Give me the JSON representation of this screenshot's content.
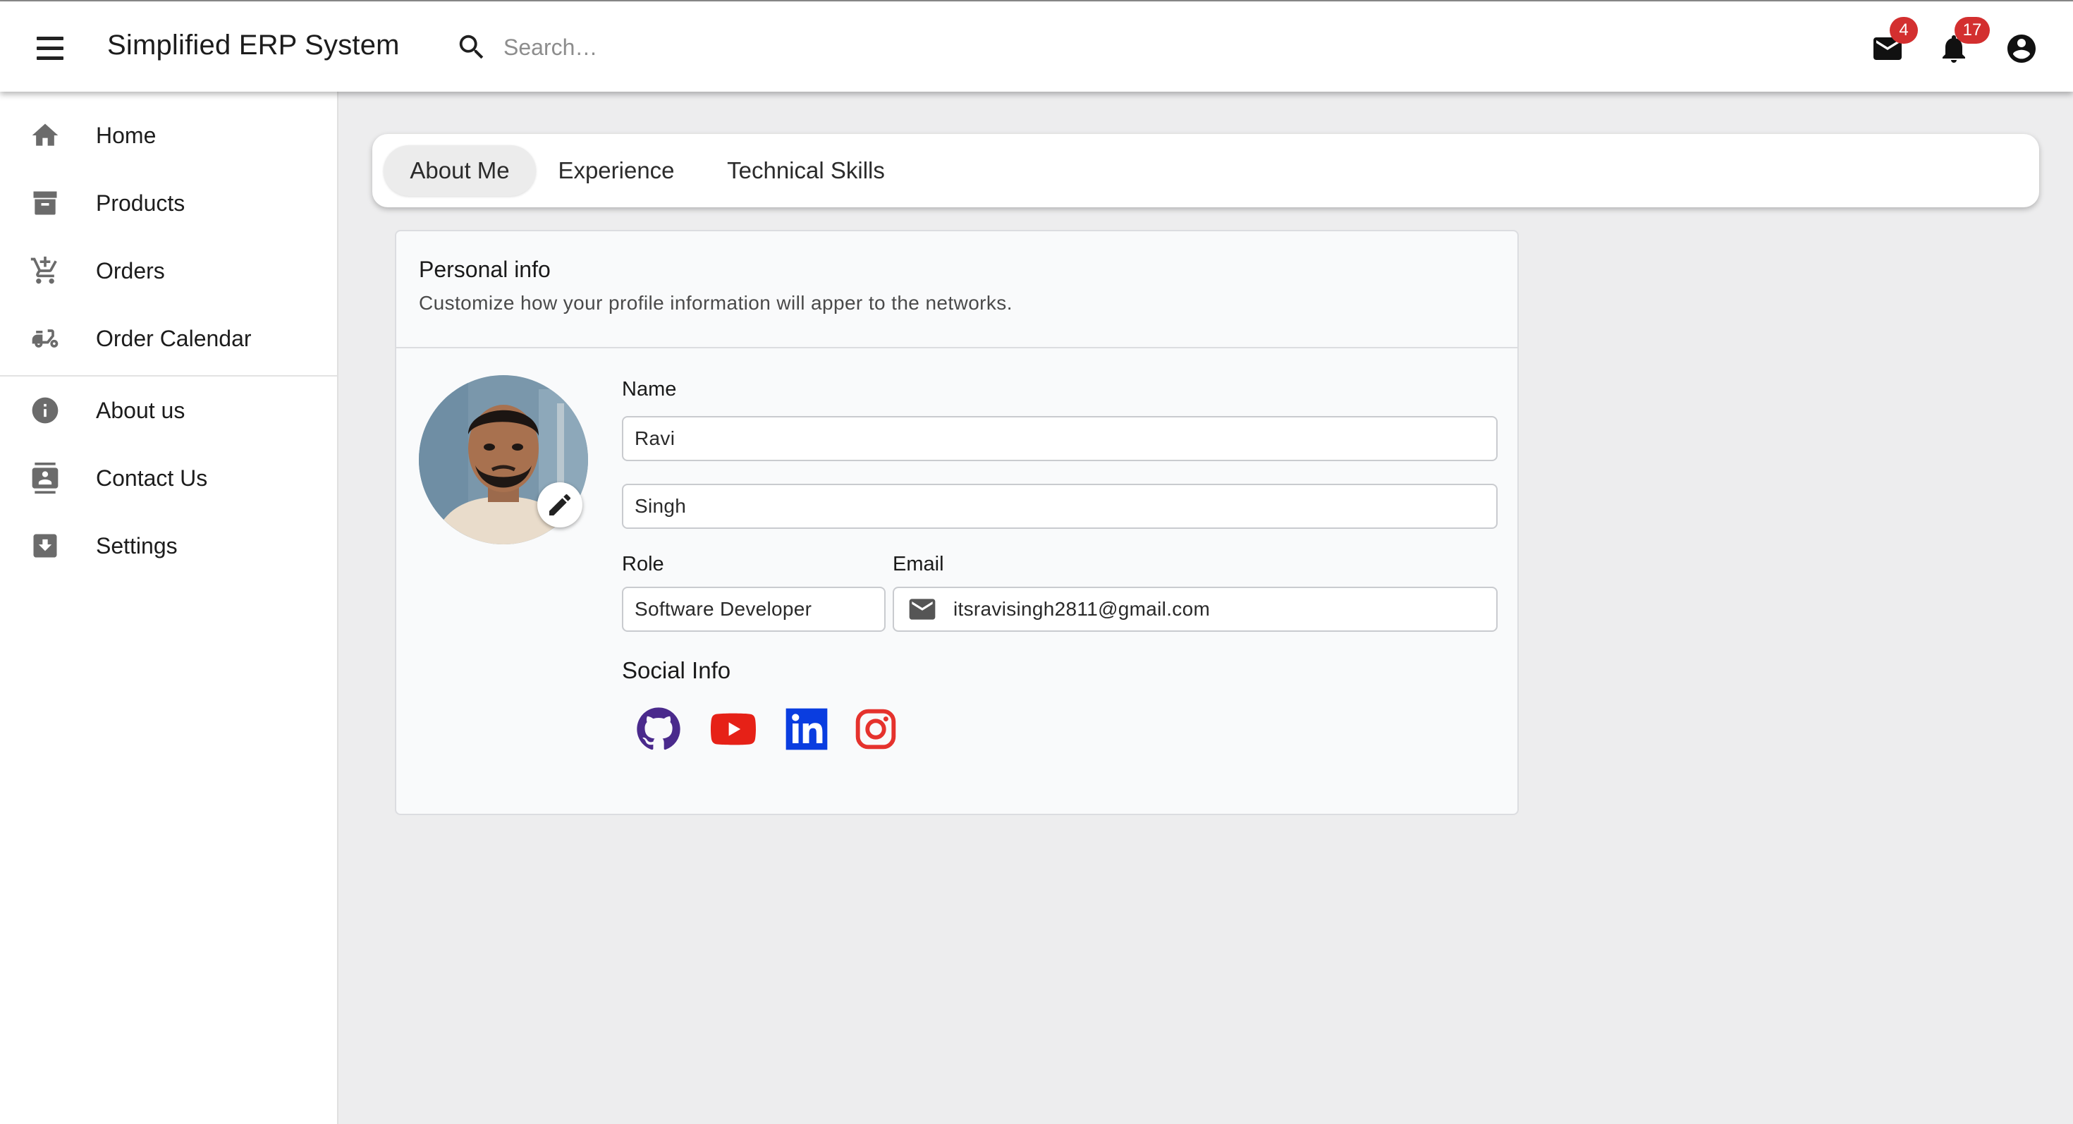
{
  "app": {
    "title": "Simplified ERP System"
  },
  "search": {
    "placeholder": "Search…"
  },
  "header": {
    "mail_badge": "4",
    "notifications_badge": "17"
  },
  "sidebar": {
    "items": [
      {
        "label": "Home",
        "icon": "home-icon"
      },
      {
        "label": "Products",
        "icon": "archive-box-icon"
      },
      {
        "label": "Orders",
        "icon": "add-shopping-cart-icon"
      },
      {
        "label": "Order Calendar",
        "icon": "delivery-scooter-icon"
      },
      {
        "label": "About us",
        "icon": "info-icon"
      },
      {
        "label": "Contact Us",
        "icon": "contact-card-icon"
      },
      {
        "label": "Settings",
        "icon": "download-box-icon"
      }
    ]
  },
  "tabs": [
    {
      "label": "About Me",
      "active": true
    },
    {
      "label": "Experience",
      "active": false
    },
    {
      "label": "Technical Skills",
      "active": false
    }
  ],
  "personal_info": {
    "title": "Personal info",
    "subtitle": "Customize how your profile information will apper to the networks.",
    "name_label": "Name",
    "first_name": "Ravi",
    "last_name": "Singh",
    "role_label": "Role",
    "role": "Software Developer",
    "email_label": "Email",
    "email": "itsravisingh2811@gmail.com",
    "social_title": "Social Info",
    "social_links": [
      "github-icon",
      "youtube-icon",
      "linkedin-icon",
      "instagram-icon"
    ]
  },
  "colors": {
    "badge": "#d32f2f",
    "github": "#4a2a8c",
    "youtube": "#e62117",
    "linkedin": "#0a3de0",
    "instagram": "#e5322d",
    "page_background": "#ededee"
  }
}
